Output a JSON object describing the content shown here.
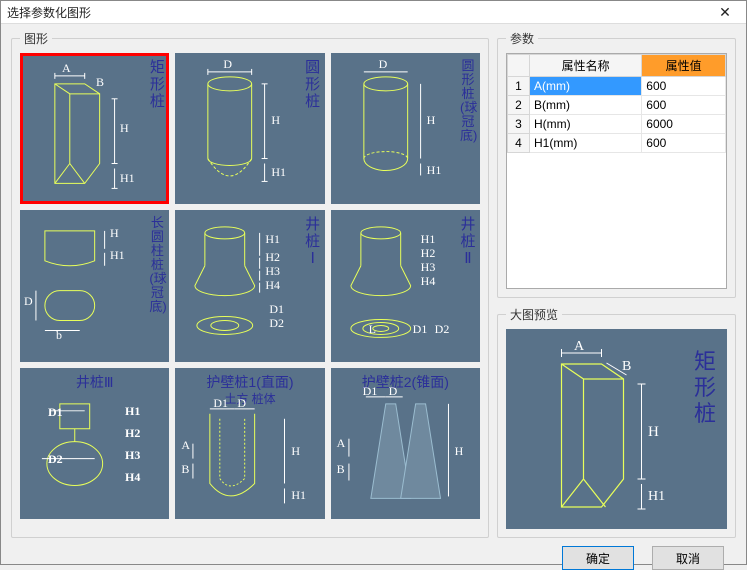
{
  "window": {
    "title": "选择参数化图形",
    "close_glyph": "✕"
  },
  "left": {
    "legend": "图形",
    "shapes": [
      {
        "id": "rect-pile",
        "label": "矩形桩",
        "dims_h": [
          "A",
          "B"
        ],
        "dims_v": [
          "H",
          "H1"
        ]
      },
      {
        "id": "circle-pile",
        "label": "圆形桩",
        "dims_h": [
          "D"
        ],
        "dims_v": [
          "H",
          "H1"
        ]
      },
      {
        "id": "circle-pile-sphere",
        "label": "圆形桩(球冠底)",
        "dims_h": [
          "D"
        ],
        "dims_v": [
          "H",
          "H1"
        ]
      },
      {
        "id": "long-cyl-sphere",
        "label": "长圆柱桩(球冠底)",
        "dims_h": [
          "D",
          "b"
        ],
        "dims_v": [
          "H",
          "H1"
        ]
      },
      {
        "id": "well-pile-1",
        "label": "井桩Ⅰ",
        "dims_h": [
          "D1",
          "D2"
        ],
        "dims_v": [
          "H1",
          "H2",
          "H3",
          "H4"
        ]
      },
      {
        "id": "well-pile-2",
        "label": "井桩Ⅱ",
        "dims_h": [
          "L",
          "D1",
          "D2"
        ],
        "dims_v": [
          "H1",
          "H2",
          "H3",
          "H4"
        ]
      },
      {
        "id": "well-pile-3",
        "label": "井桩Ⅲ",
        "title_top": true,
        "dims_h": [
          "D1",
          "D2"
        ],
        "dims_v": [
          "H1",
          "H2",
          "H3",
          "H4"
        ]
      },
      {
        "id": "guard-pile-1",
        "label": "护壁桩1(直面)",
        "title_top": true,
        "sub": "土方    桩体",
        "dims_h": [
          "D1",
          "D",
          "A",
          "B"
        ],
        "dims_v": [
          "H",
          "H1"
        ]
      },
      {
        "id": "guard-pile-2",
        "label": "护壁桩2(锥面)",
        "title_top": true,
        "dims_h": [
          "D1",
          "D",
          "A",
          "B"
        ],
        "dims_v": [
          "H"
        ]
      }
    ]
  },
  "params": {
    "legend": "参数",
    "headers": {
      "name": "属性名称",
      "value": "属性值"
    },
    "rows": [
      {
        "idx": "1",
        "name": "A(mm)",
        "value": "600",
        "selected": true
      },
      {
        "idx": "2",
        "name": "B(mm)",
        "value": "600"
      },
      {
        "idx": "3",
        "name": "H(mm)",
        "value": "6000"
      },
      {
        "idx": "4",
        "name": "H1(mm)",
        "value": "600"
      }
    ]
  },
  "preview": {
    "legend": "大图预览",
    "shape_label": "矩形桩",
    "dims": {
      "A": "A",
      "B": "B",
      "H": "H",
      "H1": "H1"
    }
  },
  "footer": {
    "ok": "确定",
    "cancel": "取消"
  }
}
